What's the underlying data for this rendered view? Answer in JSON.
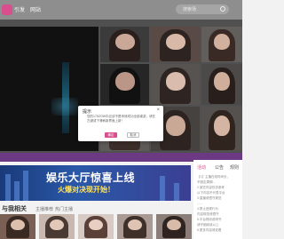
{
  "colors": {
    "accent": "#d94f8e",
    "banner": "#2a58a8",
    "strip": "#6b3a82"
  },
  "nav": {
    "items": [
      "",
      "引发",
      "网站"
    ],
    "search_placeholder": "搜索场"
  },
  "banner": {
    "title": "娱乐大厅惊喜上线",
    "subtitle": "火爆对决现开始！"
  },
  "side": {
    "tabs": [
      "活动",
      "公告",
      "规则"
    ],
    "lines": [
      "【1】主播在线时间长，",
      "不固定周期...",
      "2.某些内容仅供参考",
      "以下内容不代表平台",
      "3.直播请遵守规范",
      "......",
      "4.禁止违规行为",
      "内容规范请遵守",
      "5.平台规则说明书",
      "请仔细阅读以上",
      "6.更多内容请查看"
    ]
  },
  "related": {
    "title": "与我相关",
    "tabs": [
      "主播推荐",
      "热门主播"
    ]
  },
  "dialog": {
    "title": "提示",
    "close": "×",
    "message": "您的175ZOW中应该不是申请成功全部桌游，请在左键或下滑刷新界面上新！",
    "confirm": "确定",
    "cancel": "取消"
  }
}
